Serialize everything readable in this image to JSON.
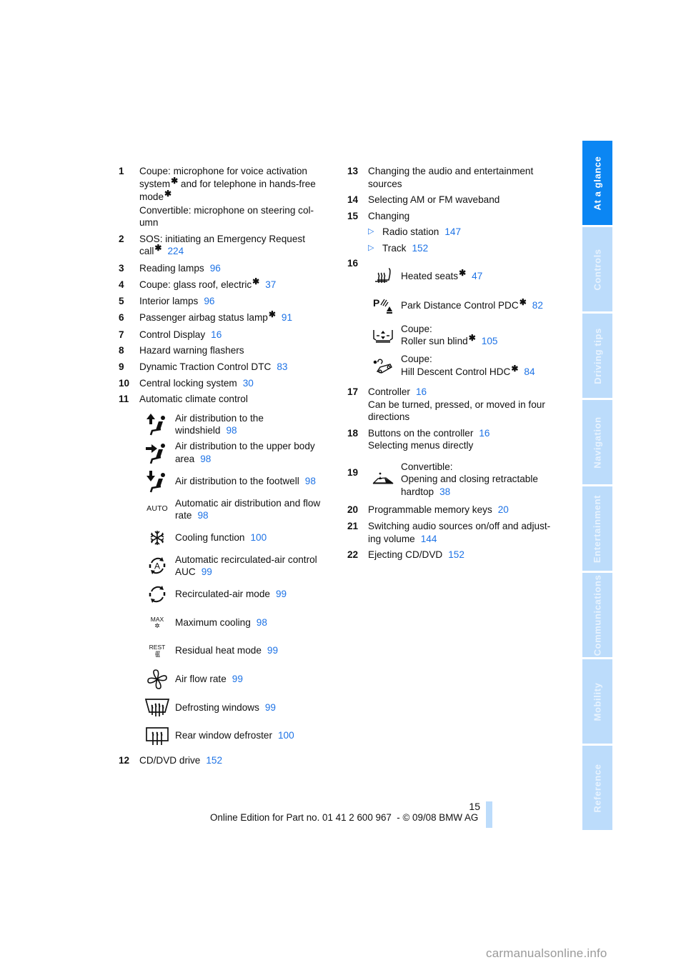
{
  "left_column": {
    "items_top": [
      {
        "num": "1",
        "lines": [
          "Coupe: microphone for voice activation",
          "system",
          "and for telephone in hands-free",
          "mode",
          "Convertible: microphone on steering col-",
          "umn"
        ]
      },
      {
        "num": "2",
        "text": "SOS: initiating an Emergency Request",
        "text2": "call",
        "ref": "224"
      },
      {
        "num": "3",
        "text": "Reading lamps",
        "ref": "96"
      },
      {
        "num": "4",
        "text": "Coupe: glass roof, electric",
        "ref": "37",
        "star": true
      },
      {
        "num": "5",
        "text": "Interior lamps",
        "ref": "96"
      },
      {
        "num": "6",
        "text": "Passenger airbag status lamp",
        "ref": "91",
        "star": true
      },
      {
        "num": "7",
        "text": "Control Display",
        "ref": "16"
      },
      {
        "num": "8",
        "text": "Hazard warning flashers"
      },
      {
        "num": "9",
        "text": "Dynamic Traction Control DTC",
        "ref": "83"
      },
      {
        "num": "10",
        "text": "Central locking system",
        "ref": "30"
      },
      {
        "num": "11",
        "text": "Automatic climate control"
      }
    ],
    "climate_icons": [
      {
        "icon": "air-windshield-icon",
        "text": "Air distribution to the",
        "text2": "windshield",
        "ref": "98"
      },
      {
        "icon": "air-upper-body-icon",
        "text": "Air distribution to the upper body",
        "text2": "area",
        "ref": "98"
      },
      {
        "icon": "air-footwell-icon",
        "text": "Air distribution to the footwell",
        "ref": "98"
      },
      {
        "icon": "auto-icon",
        "icon_label": "AUTO",
        "text": "Automatic air distribution and flow",
        "text2": "rate",
        "ref": "98"
      },
      {
        "icon": "snowflake-icon",
        "text": "Cooling function",
        "ref": "100"
      },
      {
        "icon": "auc-icon",
        "icon_label": "A",
        "text": "Automatic recirculated-air control",
        "text2": "AUC",
        "ref": "99"
      },
      {
        "icon": "recirculation-icon",
        "text": "Recirculated-air mode",
        "ref": "99"
      },
      {
        "icon": "max-cooling-icon",
        "icon_label": "MAX",
        "text": "Maximum cooling",
        "ref": "98"
      },
      {
        "icon": "residual-heat-icon",
        "icon_label": "REST",
        "text": "Residual heat mode",
        "ref": "99"
      },
      {
        "icon": "fan-icon",
        "text": "Air flow rate",
        "ref": "99"
      },
      {
        "icon": "windshield-defrost-icon",
        "text": "Defrosting windows",
        "ref": "99"
      },
      {
        "icon": "rear-defrost-icon",
        "text": "Rear window defroster",
        "ref": "100"
      }
    ],
    "item_12": {
      "num": "12",
      "text": "CD/DVD drive",
      "ref": "152"
    }
  },
  "right_column": {
    "item_13": {
      "num": "13",
      "text": "Changing the audio and entertainment",
      "text2": "sources"
    },
    "item_14": {
      "num": "14",
      "text": "Selecting AM or FM waveband"
    },
    "item_15": {
      "num": "15",
      "text": "Changing",
      "subitems": [
        {
          "bullet": "▷",
          "text": "Radio station",
          "ref": "147"
        },
        {
          "bullet": "▷",
          "text": "Track",
          "ref": "152"
        }
      ]
    },
    "item_16": {
      "num": "16",
      "icons": [
        {
          "icon": "heated-seat-icon",
          "text": "Heated seats",
          "ref": "47",
          "star": true
        },
        {
          "icon": "pdc-icon",
          "icon_label": "P",
          "text": "Park Distance Control PDC",
          "ref": "82",
          "star": true
        },
        {
          "icon": "sun-blind-icon",
          "text": "Coupe:",
          "text2": "Roller sun blind",
          "ref": "105",
          "star": true
        },
        {
          "icon": "hdc-icon",
          "text": "Coupe:",
          "text2": "Hill Descent Control HDC",
          "ref": "84",
          "star": true
        }
      ]
    },
    "item_17": {
      "num": "17",
      "text": "Controller",
      "ref": "16",
      "text2": "Can be turned, pressed, or moved in four",
      "text3": "directions"
    },
    "item_18": {
      "num": "18",
      "text": "Buttons on the controller",
      "ref": "16",
      "text2": "Selecting menus directly"
    },
    "item_19": {
      "num": "19",
      "icon": "hardtop-icon",
      "text": "Convertible:",
      "text2": "Opening and closing retractable",
      "text3": "hardtop",
      "ref": "38"
    },
    "item_20": {
      "num": "20",
      "text": "Programmable memory keys",
      "ref": "20"
    },
    "item_21": {
      "num": "21",
      "text": "Switching audio sources on/off and adjust-",
      "text2": "ing volume",
      "ref": "144"
    },
    "item_22": {
      "num": "22",
      "text": "Ejecting CD/DVD",
      "ref": "152"
    }
  },
  "star_glyph": "✱",
  "sidebar": {
    "tabs": [
      {
        "label": "At a glance",
        "active": true
      },
      {
        "label": "Controls",
        "active": false
      },
      {
        "label": "Driving tips",
        "active": false
      },
      {
        "label": "Navigation",
        "active": false
      },
      {
        "label": "Entertainment",
        "active": false
      },
      {
        "label": "Communications",
        "active": false
      },
      {
        "label": "Mobility",
        "active": false
      },
      {
        "label": "Reference",
        "active": false
      }
    ],
    "active_color": "#0b86f3",
    "inactive_color": "#bcdcfb"
  },
  "footer": {
    "page_number": "15",
    "edition_text": "Online Edition for Part no. 01 41 2 600 967  - © 09/08 BMW AG"
  },
  "watermark": "carmanualsonline.info",
  "link_color": "#1e73e6"
}
